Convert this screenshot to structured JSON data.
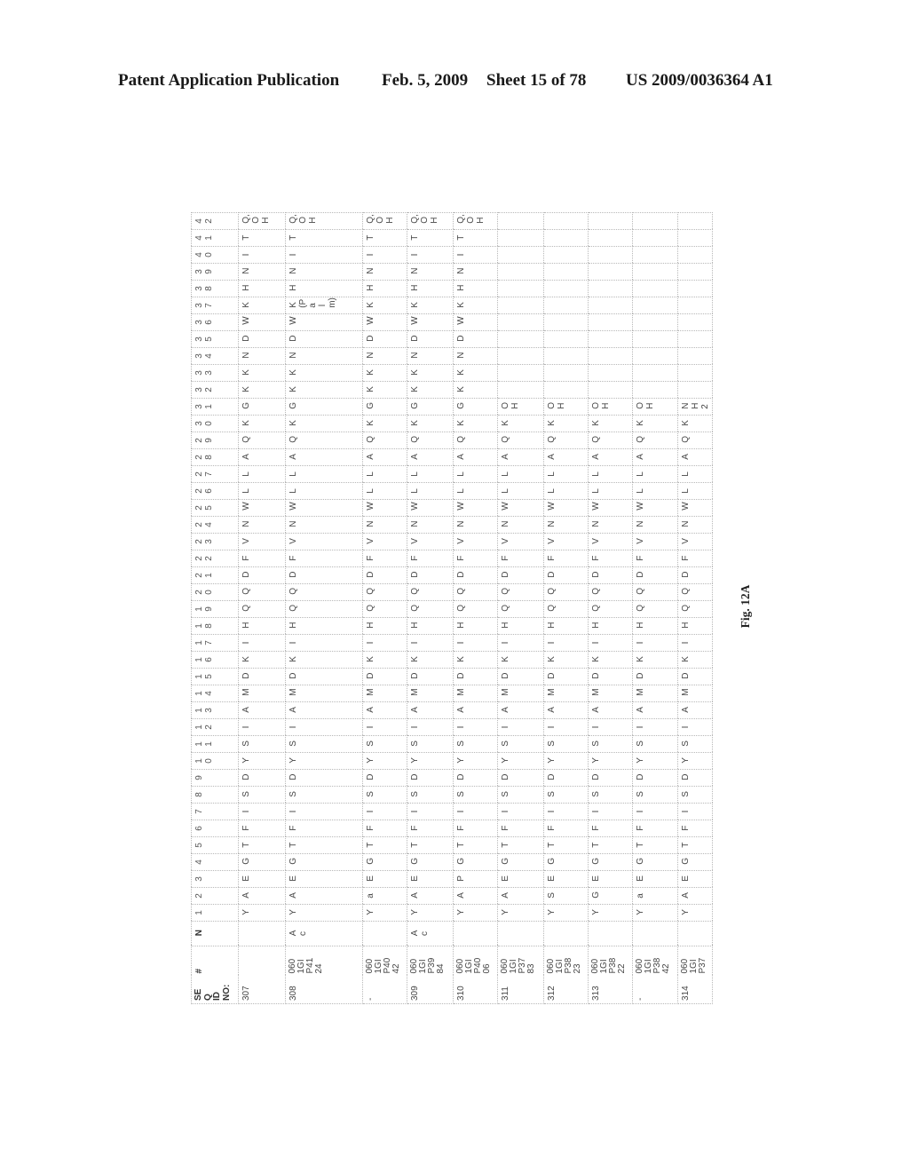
{
  "page_header": {
    "title": "Patent Application Publication",
    "date": "Feb. 5, 2009",
    "sheet": "Sheet 15 of 78",
    "pub_number": "US 2009/0036364 A1"
  },
  "figure_label": "Fig. 12A",
  "table": {
    "headers": {
      "seq_id": "SEQ ID NO:",
      "number": "#",
      "n_term": "N",
      "positions": [
        "1",
        "2",
        "3",
        "4",
        "5",
        "6",
        "7",
        "8",
        "9",
        "10",
        "11",
        "12",
        "13",
        "14",
        "15",
        "16",
        "17",
        "18",
        "19",
        "20",
        "21",
        "22",
        "23",
        "24",
        "25",
        "26",
        "27",
        "28",
        "29",
        "30",
        "31",
        "32",
        "33",
        "34",
        "35",
        "36",
        "37",
        "38",
        "39",
        "40",
        "41",
        "42"
      ]
    },
    "rows": [
      {
        "seq_id": "307",
        "number": "",
        "n_term": "",
        "residues": [
          "Y",
          "A",
          "E",
          "G",
          "T",
          "F",
          "I",
          "S",
          "D",
          "Y",
          "S",
          "I",
          "A",
          "M",
          "D",
          "K",
          "I",
          "H",
          "Q",
          "Q",
          "D",
          "F",
          "V",
          "N",
          "W",
          "L",
          "L",
          "A",
          "Q",
          "K",
          "G",
          "K",
          "K",
          "N",
          "D",
          "W",
          "K",
          "H",
          "N",
          "I",
          "T",
          "Q,OH"
        ]
      },
      {
        "seq_id": "308",
        "number": "060 1GI P41 24",
        "n_term": "Ac",
        "residues": [
          "Y",
          "A",
          "E",
          "G",
          "T",
          "F",
          "I",
          "S",
          "D",
          "Y",
          "S",
          "I",
          "A",
          "M",
          "D",
          "K",
          "I",
          "H",
          "Q",
          "Q",
          "D",
          "F",
          "V",
          "N",
          "W",
          "L",
          "L",
          "A",
          "Q",
          "K",
          "G",
          "K",
          "K",
          "N",
          "D",
          "W",
          "K(Palm)",
          "H",
          "N",
          "I",
          "T",
          "Q,OH"
        ]
      },
      {
        "seq_id": "-",
        "number": "060 1GI P40 42",
        "n_term": "",
        "residues": [
          "Y",
          "a",
          "E",
          "G",
          "T",
          "F",
          "I",
          "S",
          "D",
          "Y",
          "S",
          "I",
          "A",
          "M",
          "D",
          "K",
          "I",
          "H",
          "Q",
          "Q",
          "D",
          "F",
          "V",
          "N",
          "W",
          "L",
          "L",
          "A",
          "Q",
          "K",
          "G",
          "K",
          "K",
          "N",
          "D",
          "W",
          "K",
          "H",
          "N",
          "I",
          "T",
          "Q,OH"
        ]
      },
      {
        "seq_id": "309",
        "number": "060 1GI P39 84",
        "n_term": "Ac",
        "residues": [
          "Y",
          "A",
          "E",
          "G",
          "T",
          "F",
          "I",
          "S",
          "D",
          "Y",
          "S",
          "I",
          "A",
          "M",
          "D",
          "K",
          "I",
          "H",
          "Q",
          "Q",
          "D",
          "F",
          "V",
          "N",
          "W",
          "L",
          "L",
          "A",
          "Q",
          "K",
          "G",
          "K",
          "K",
          "N",
          "D",
          "W",
          "K",
          "H",
          "N",
          "I",
          "T",
          "Q,OH"
        ]
      },
      {
        "seq_id": "310",
        "number": "060 1GI P40 06",
        "n_term": "",
        "residues": [
          "Y",
          "A",
          "P",
          "G",
          "T",
          "F",
          "I",
          "S",
          "D",
          "Y",
          "S",
          "I",
          "A",
          "M",
          "D",
          "K",
          "I",
          "H",
          "Q",
          "Q",
          "D",
          "F",
          "V",
          "N",
          "W",
          "L",
          "L",
          "A",
          "Q",
          "K",
          "G",
          "K",
          "K",
          "N",
          "D",
          "W",
          "K",
          "H",
          "N",
          "I",
          "T",
          "Q,OH"
        ]
      },
      {
        "seq_id": "311",
        "number": "060 1GI P37 83",
        "n_term": "",
        "residues": [
          "Y",
          "A",
          "E",
          "G",
          "T",
          "F",
          "I",
          "S",
          "D",
          "Y",
          "S",
          "I",
          "A",
          "M",
          "D",
          "K",
          "I",
          "H",
          "Q",
          "Q",
          "D",
          "F",
          "V",
          "N",
          "W",
          "L",
          "L",
          "A",
          "Q",
          "K",
          "OH",
          "",
          "",
          "",
          "",
          "",
          "",
          "",
          "",
          "",
          "",
          ""
        ]
      },
      {
        "seq_id": "312",
        "number": "060 1GI P38 23",
        "n_term": "",
        "residues": [
          "Y",
          "S",
          "E",
          "G",
          "T",
          "F",
          "I",
          "S",
          "D",
          "Y",
          "S",
          "I",
          "A",
          "M",
          "D",
          "K",
          "I",
          "H",
          "Q",
          "Q",
          "D",
          "F",
          "V",
          "N",
          "W",
          "L",
          "L",
          "A",
          "Q",
          "K",
          "OH",
          "",
          "",
          "",
          "",
          "",
          "",
          "",
          "",
          "",
          "",
          ""
        ]
      },
      {
        "seq_id": "313",
        "number": "060 1GI P38 22",
        "n_term": "",
        "residues": [
          "Y",
          "G",
          "E",
          "G",
          "T",
          "F",
          "I",
          "S",
          "D",
          "Y",
          "S",
          "I",
          "A",
          "M",
          "D",
          "K",
          "I",
          "H",
          "Q",
          "Q",
          "D",
          "F",
          "V",
          "N",
          "W",
          "L",
          "L",
          "A",
          "Q",
          "K",
          "OH",
          "",
          "",
          "",
          "",
          "",
          "",
          "",
          "",
          "",
          "",
          ""
        ]
      },
      {
        "seq_id": "-",
        "number": "060 1GI P38 42",
        "n_term": "",
        "residues": [
          "Y",
          "a",
          "E",
          "G",
          "T",
          "F",
          "I",
          "S",
          "D",
          "Y",
          "S",
          "I",
          "A",
          "M",
          "D",
          "K",
          "I",
          "H",
          "Q",
          "Q",
          "D",
          "F",
          "V",
          "N",
          "W",
          "L",
          "L",
          "A",
          "Q",
          "K",
          "OH",
          "",
          "",
          "",
          "",
          "",
          "",
          "",
          "",
          "",
          "",
          ""
        ]
      },
      {
        "seq_id": "314",
        "number": "060 1GI P37",
        "n_term": "",
        "residues": [
          "Y",
          "A",
          "E",
          "G",
          "T",
          "F",
          "I",
          "S",
          "D",
          "Y",
          "S",
          "I",
          "A",
          "M",
          "D",
          "K",
          "I",
          "H",
          "Q",
          "Q",
          "D",
          "F",
          "V",
          "N",
          "W",
          "L",
          "L",
          "A",
          "Q",
          "K",
          "NH2",
          "",
          "",
          "",
          "",
          "",
          "",
          "",
          "",
          "",
          "",
          ""
        ]
      }
    ]
  }
}
